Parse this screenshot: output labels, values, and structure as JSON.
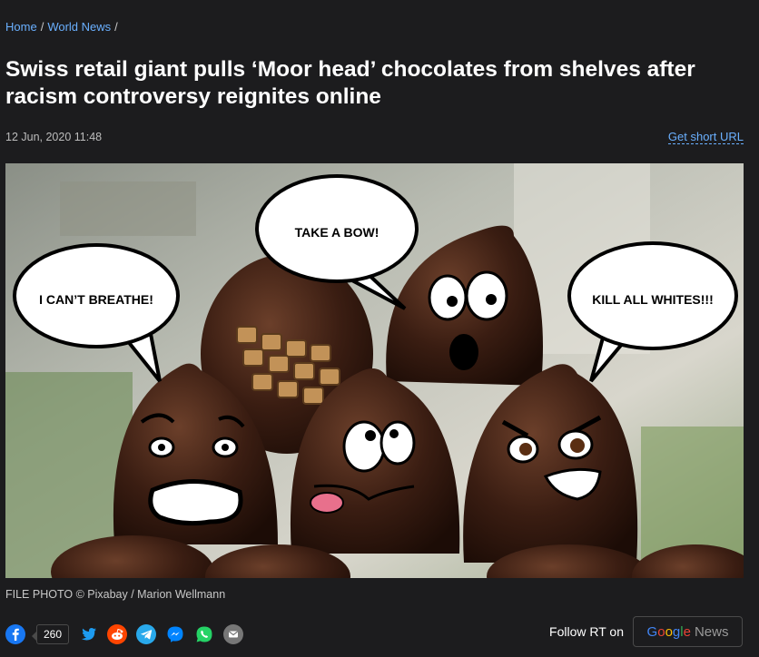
{
  "breadcrumb": {
    "items": [
      "Home",
      "World News"
    ],
    "separator": "/"
  },
  "article": {
    "title": "Swiss retail giant pulls ‘Moor head’ chocolates from shelves after racism controversy reignites online",
    "date": "12 Jun, 2020 11:48",
    "short_url_label": "Get short URL"
  },
  "image": {
    "speech_bubbles": [
      "TAKE A BOW!",
      "I CAN’T BREATHE!",
      "KILL ALL WHITES!!!"
    ],
    "caption": "FILE PHOTO © Pixabay / Marion Wellmann"
  },
  "share": {
    "facebook_count": "260",
    "icons": [
      "facebook-icon",
      "twitter-icon",
      "reddit-icon",
      "telegram-icon",
      "messenger-icon",
      "whatsapp-icon",
      "email-icon"
    ]
  },
  "follow": {
    "label": "Follow RT on",
    "google_letters": [
      "G",
      "o",
      "o",
      "g",
      "l",
      "e"
    ],
    "google_colors": [
      "#4285F4",
      "#EA4335",
      "#FBBC05",
      "#4285F4",
      "#34A853",
      "#EA4335"
    ],
    "news_label": "News"
  },
  "colors": {
    "background": "#1c1c1e",
    "link": "#6ab0ff",
    "facebook": "#1877f2",
    "twitter": "#1d9bf0",
    "reddit": "#ff4500",
    "telegram": "#29a9eb",
    "messenger": "#0084ff",
    "whatsapp": "#25d366",
    "email": "#777777"
  }
}
